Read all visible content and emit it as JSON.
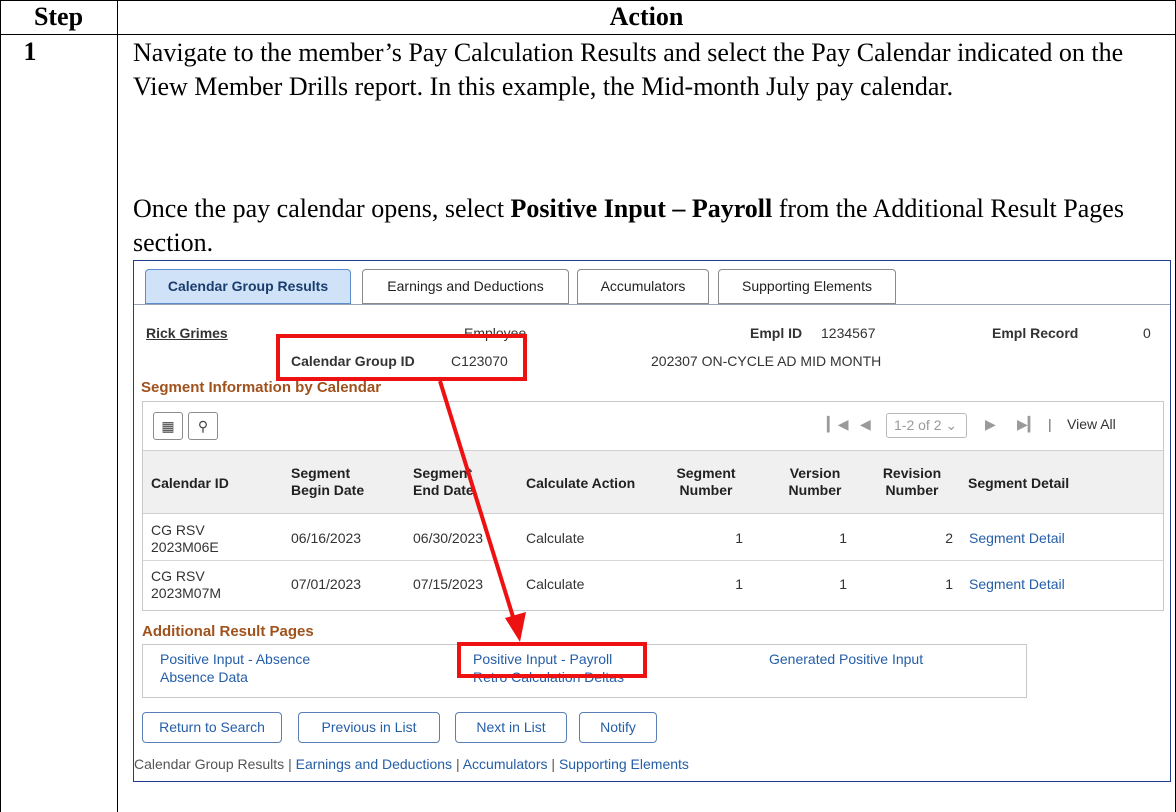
{
  "table": {
    "header_step": "Step",
    "header_action": "Action",
    "step_number": "1",
    "para1": "Navigate to the member’s Pay Calculation Results and select the Pay Calendar indicated on the View Member Drills report. In this example, the Mid-month July pay calendar.",
    "para2_before": "Once the pay calendar opens, select ",
    "para2_bold": "Positive Input – Payroll",
    "para2_after": " from the Additional Result Pages section."
  },
  "tabs": [
    {
      "label": "Calendar Group Results"
    },
    {
      "label": "Earnings and Deductions"
    },
    {
      "label": "Accumulators"
    },
    {
      "label": "Supporting Elements"
    }
  ],
  "employee": {
    "name": "Rick Grimes",
    "type": "Employee",
    "empl_id_label": "Empl ID",
    "empl_id": "1234567",
    "empl_record_label": "Empl Record",
    "empl_record": "0",
    "cal_group_label": "Calendar Group ID",
    "cal_group_id": "C123070",
    "cal_group_desc": "202307 ON-CYCLE AD MID MONTH"
  },
  "segment_section_title": "Segment Information by Calendar",
  "pager": {
    "range": "1-2 of 2",
    "view_all": "View All"
  },
  "grid_columns": [
    "Calendar ID",
    "Segment Begin Date",
    "Segment End Date",
    "Calculate Action",
    "Segment Number",
    "Version Number",
    "Revision Number",
    "Segment Detail"
  ],
  "grid_rows": [
    {
      "calendar_id_1": "CG RSV",
      "calendar_id_2": "2023M06E",
      "begin": "06/16/2023",
      "end": "06/30/2023",
      "action": "Calculate",
      "segment": "1",
      "version": "1",
      "revision": "2",
      "detail": "Segment Detail"
    },
    {
      "calendar_id_1": "CG RSV",
      "calendar_id_2": "2023M07M",
      "begin": "07/01/2023",
      "end": "07/15/2023",
      "action": "Calculate",
      "segment": "1",
      "version": "1",
      "revision": "1",
      "detail": "Segment Detail"
    }
  ],
  "additional": {
    "title": "Additional Result Pages",
    "positive_input_absence": "Positive Input - Absence",
    "absence_data": "Absence Data",
    "positive_input_payroll": "Positive Input - Payroll",
    "retro_calc_deltas": "Retro Calculation Deltas",
    "generated_positive_input": "Generated Positive Input"
  },
  "buttons": {
    "return_to_search": "Return to Search",
    "previous_in_list": "Previous in List",
    "next_in_list": "Next in List",
    "notify": "Notify"
  },
  "footer": {
    "item1": "Calendar Group Results",
    "item2": "Earnings and Deductions",
    "item3": "Accumulators",
    "item4": "Supporting Elements",
    "sep": "|"
  },
  "colors": {
    "accent_red": "#ee1111",
    "link_blue": "#245ea8",
    "section_orange": "#a0521d",
    "active_tab": "#cfe2f7"
  }
}
